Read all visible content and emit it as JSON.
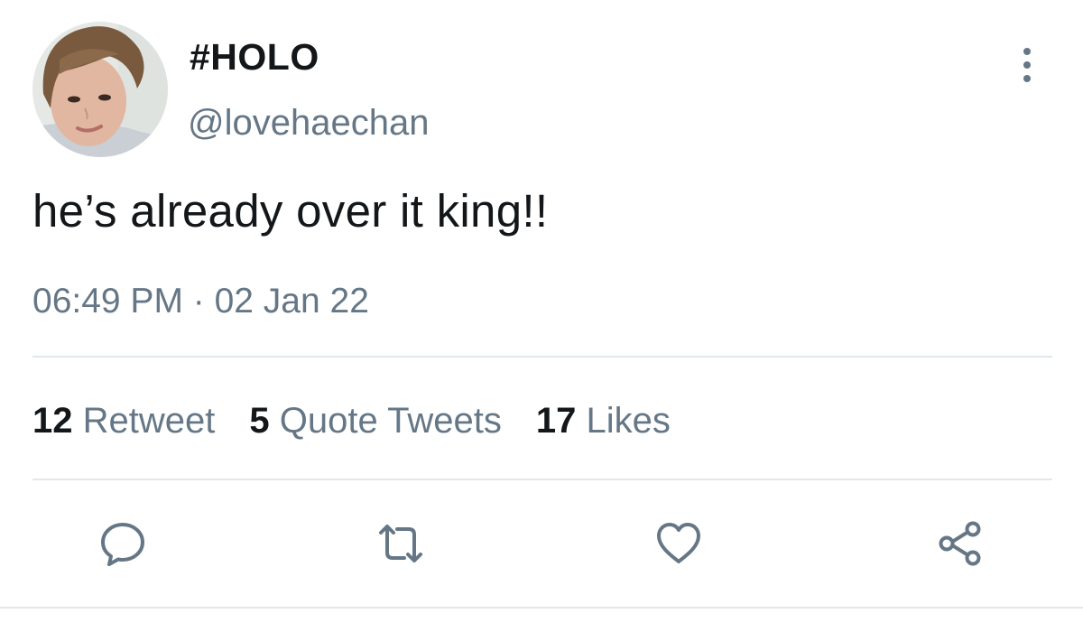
{
  "tweet": {
    "display_name": "#HOLO",
    "username": "@lovehaechan",
    "text": "he’s already over it king!!",
    "timestamp": "06:49 PM · 02 Jan 22",
    "stats": {
      "retweets": {
        "count": "12",
        "label": "Retweet"
      },
      "quotes": {
        "count": "5",
        "label": "Quote Tweets"
      },
      "likes": {
        "count": "17",
        "label": "Likes"
      }
    },
    "actions": {
      "reply_icon": "reply-icon",
      "retweet_icon": "retweet-icon",
      "like_icon": "heart-icon",
      "share_icon": "share-icon"
    }
  },
  "colors": {
    "primary_text": "#14171a",
    "secondary_text": "#657786",
    "divider": "#e1e8ed"
  }
}
